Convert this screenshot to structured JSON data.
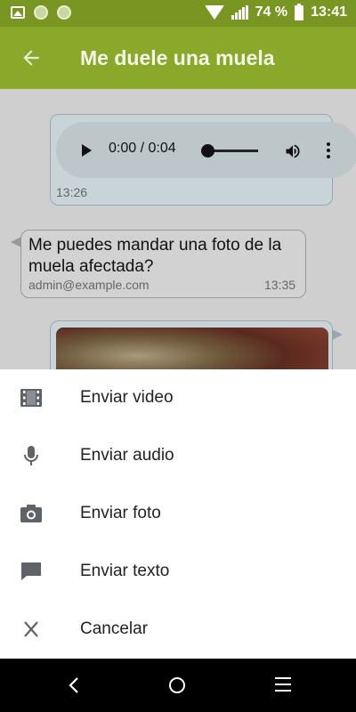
{
  "statusbar": {
    "battery_text": "74 %",
    "time": "13:41"
  },
  "appbar": {
    "title": "Me duele una muela"
  },
  "messages": [
    {
      "type": "audio",
      "player_time": "0:00 / 0:04",
      "timestamp": "13:26"
    },
    {
      "type": "text",
      "text": "Me puedes mandar una foto de la muela afectada?",
      "sender": "admin@example.com",
      "timestamp": "13:35"
    },
    {
      "type": "photo"
    }
  ],
  "sheet": {
    "items": [
      {
        "label": "Enviar video",
        "icon": "video-icon"
      },
      {
        "label": "Enviar audio",
        "icon": "microphone-icon"
      },
      {
        "label": "Enviar foto",
        "icon": "camera-icon"
      },
      {
        "label": "Enviar texto",
        "icon": "chat-bubble-icon"
      },
      {
        "label": "Cancelar",
        "icon": "close-icon"
      }
    ]
  },
  "colors": {
    "statusbar": "#7a9622",
    "appbar": "#8aa829",
    "icon": "#5f6368"
  }
}
